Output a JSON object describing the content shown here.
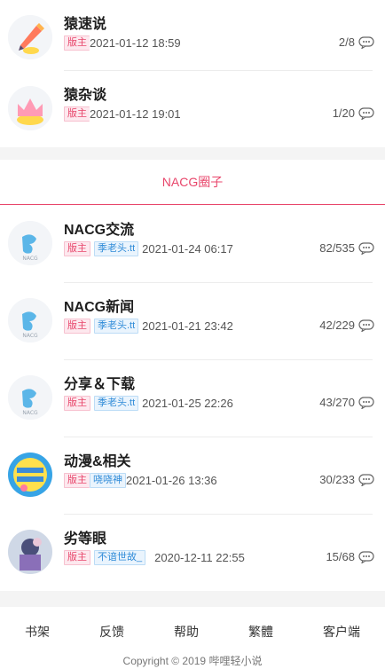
{
  "forums_top": [
    {
      "title": "猿速说",
      "admin_tag": "版主",
      "user_tag": "",
      "time": "2021-01-12 18:59",
      "counts": "2/8"
    },
    {
      "title": "猿杂谈",
      "admin_tag": "版主",
      "user_tag": "",
      "time": "2021-01-12 19:01",
      "counts": "1/20"
    }
  ],
  "section": {
    "title": "NACG圈子"
  },
  "forums_nacg": [
    {
      "title": "NACG交流",
      "admin_tag": "版主",
      "user_tag": "季老头.tt",
      "time": "2021-01-24 06:17",
      "counts": "82/535"
    },
    {
      "title": "NACG新闻",
      "admin_tag": "版主",
      "user_tag": "季老头.tt",
      "time": "2021-01-21 23:42",
      "counts": "42/229"
    },
    {
      "title": "分享＆下载",
      "admin_tag": "版主",
      "user_tag": "季老头.tt",
      "time": "2021-01-25 22:26",
      "counts": "43/270"
    },
    {
      "title": "动漫&相关",
      "admin_tag": "版主",
      "user_tag": "哓哓神",
      "time": "2021-01-26 13:36",
      "counts": "30/233"
    },
    {
      "title": "劣等眼",
      "admin_tag": "版主",
      "user_tag": "不谙世故_",
      "time": "2020-12-11 22:55",
      "counts": "15/68"
    }
  ],
  "footer": {
    "links": [
      "书架",
      "反馈",
      "帮助",
      "繁體",
      "客户端"
    ],
    "copyright": "Copyright © 2019 哔哩轻小说"
  },
  "icons": {
    "comment": "comment-bubble-icon",
    "avatar_top_1": "pencil-icon",
    "avatar_top_2": "crown-icon",
    "avatar_nacg": "nacg-logo-icon"
  },
  "colors": {
    "accent": "#e8466b",
    "user_tag": "#2f8bd8"
  }
}
